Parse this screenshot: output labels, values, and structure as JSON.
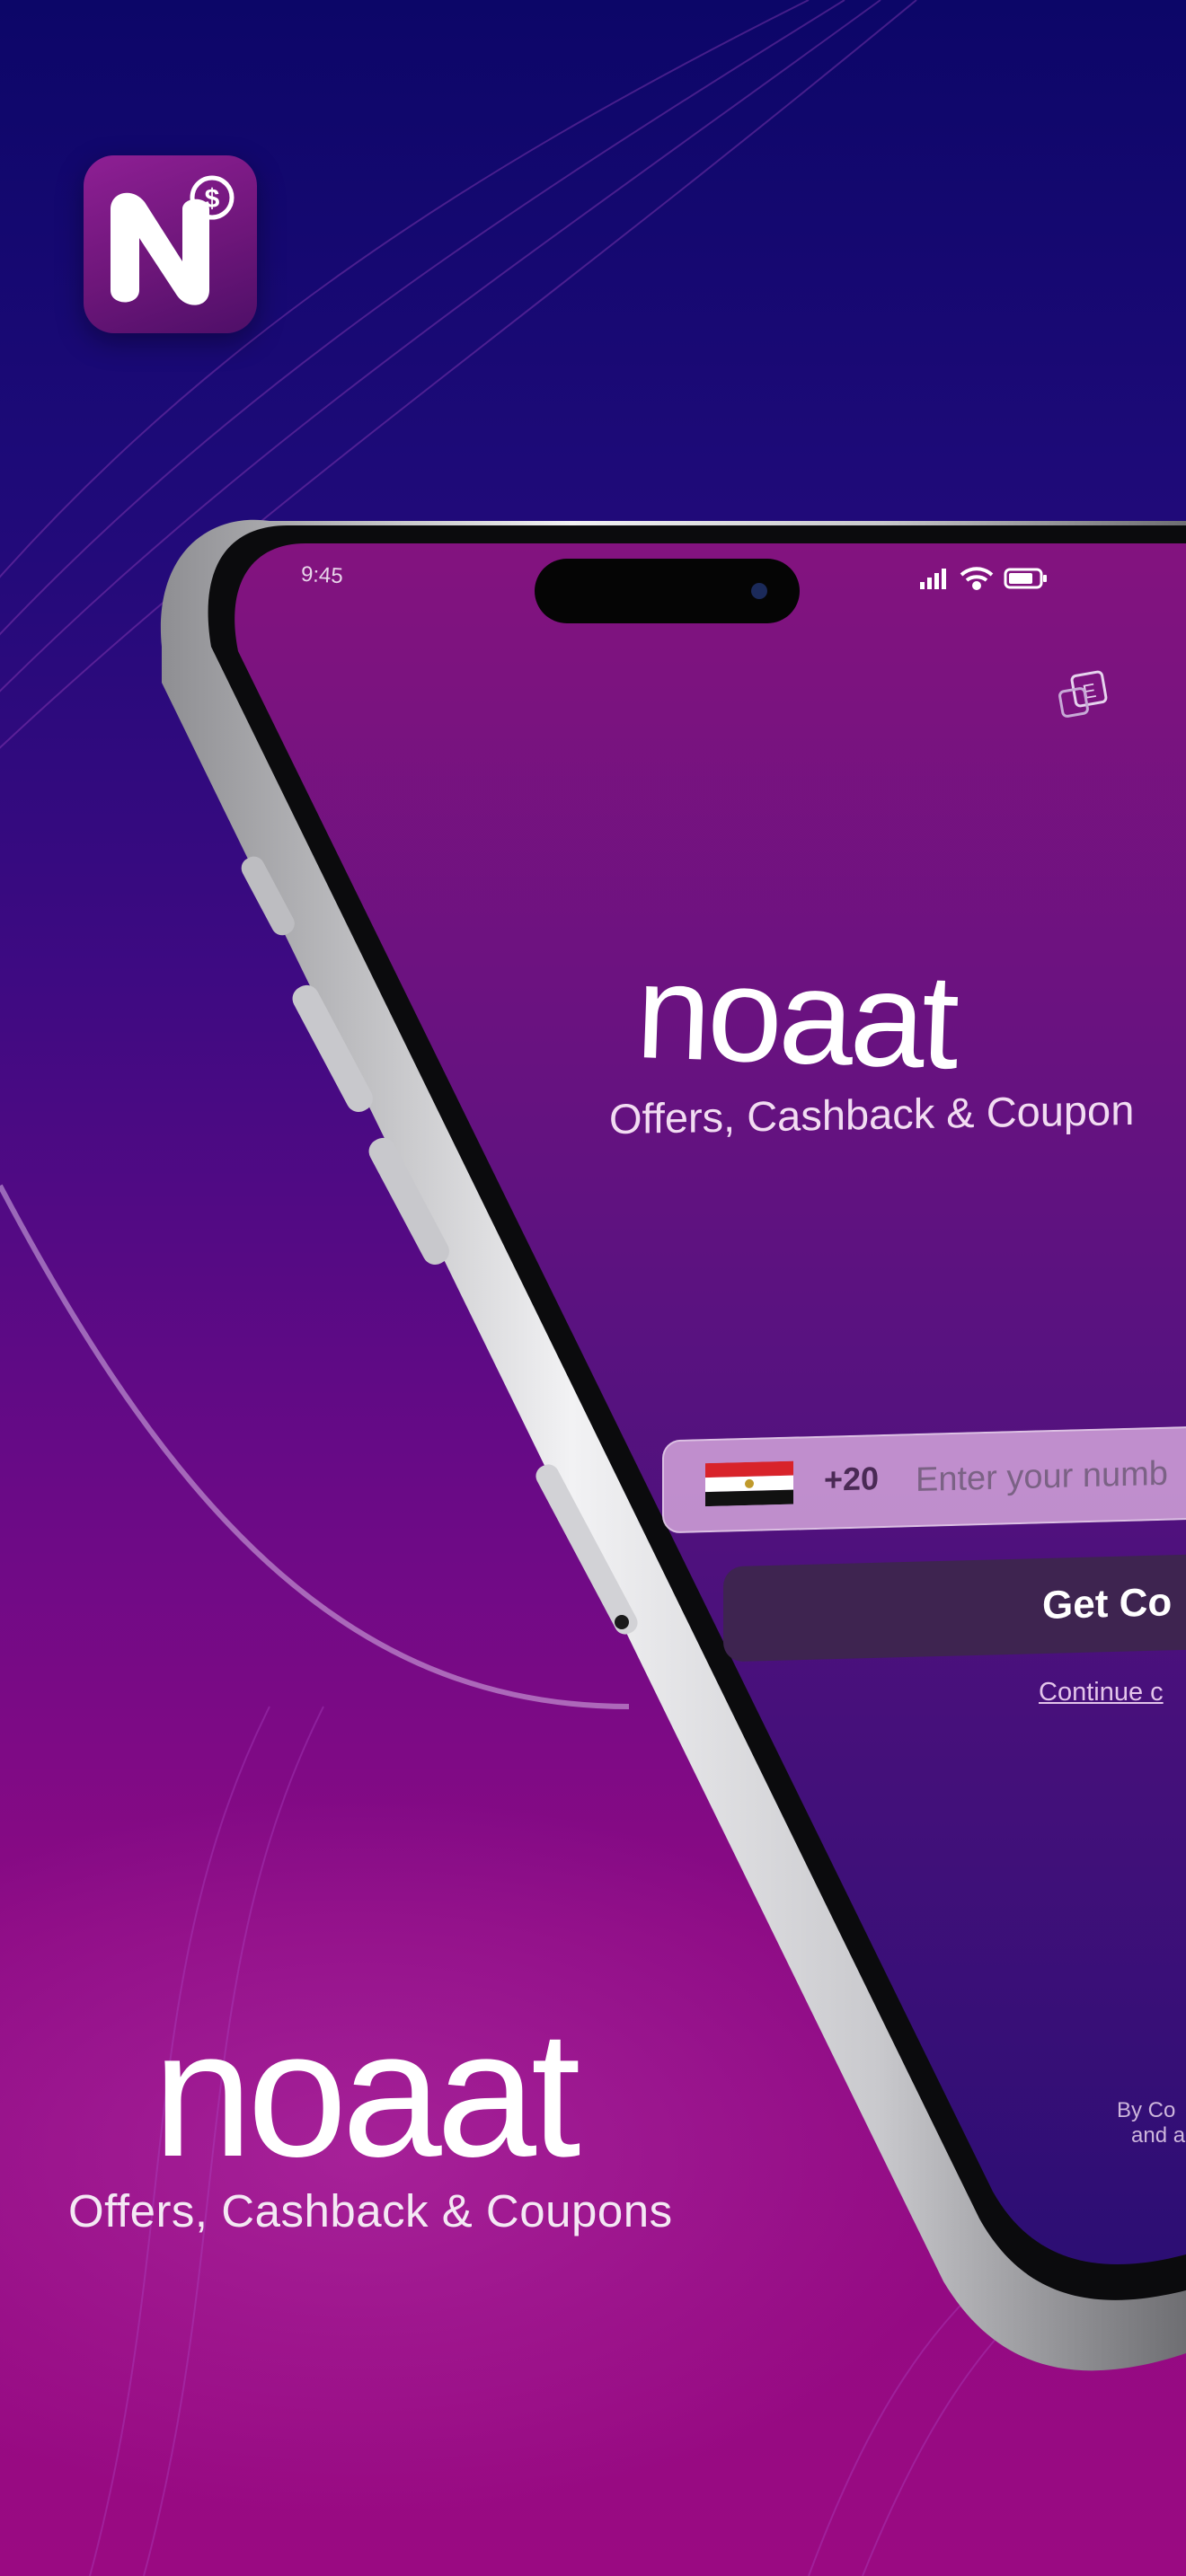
{
  "brand": {
    "name": "noaat",
    "tagline": "Offers, Cashback & Coupons"
  },
  "phone_screen": {
    "status_time": "9:45",
    "logo": "noaat",
    "tagline": "Offers, Cashback & Coupon",
    "phone_field": {
      "country_code": "+20",
      "placeholder": "Enter your numb",
      "value": ""
    },
    "get_code_label": "Get Co",
    "continue_label": "Continue c",
    "terms_text_line1": "By Co",
    "terms_text_line2": "and a"
  },
  "colors": {
    "background_top": "#0c0668",
    "background_bottom": "#9a0a82",
    "screen_top": "#83137f",
    "screen_bottom": "#2c0e74",
    "button_dark": "#3e2450",
    "field_lilac": "#d8aade"
  },
  "icons": [
    "app-icon-n-dollar",
    "signal-icon",
    "wifi-icon",
    "battery-icon",
    "language-toggle-icon",
    "egypt-flag-icon"
  ]
}
